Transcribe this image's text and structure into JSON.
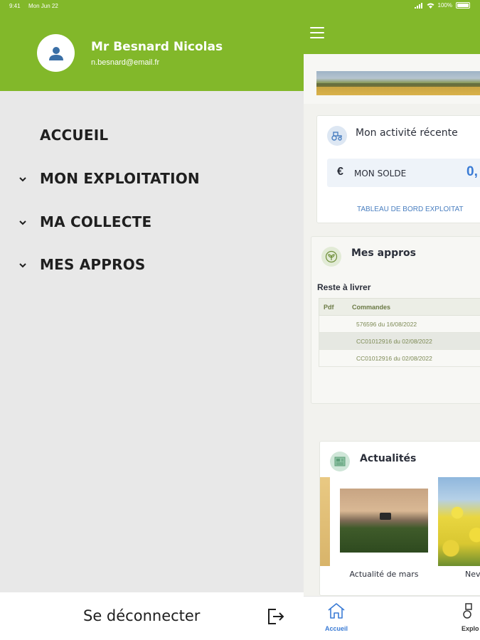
{
  "status_bar": {
    "time": "9:41",
    "date": "Mon Jun 22",
    "battery": "100%"
  },
  "drawer": {
    "user": {
      "name": "Mr Besnard Nicolas",
      "email": "n.besnard@email.fr",
      "avatar_icon": "user-icon"
    },
    "menu": [
      {
        "label": "ACCUEIL",
        "expandable": false
      },
      {
        "label": "MON EXPLOITATION",
        "expandable": true
      },
      {
        "label": "MA COLLECTE",
        "expandable": true
      },
      {
        "label": "MES APPROS",
        "expandable": true
      }
    ],
    "logout_label": "Se déconnecter"
  },
  "app": {
    "header_icon": "hamburger-icon",
    "activity": {
      "title": "Mon activité récente",
      "currency_symbol": "€",
      "solde_label": "MON SOLDE",
      "solde_value": "0,",
      "dashboard_link": "TABLEAU DE BORD EXPLOITAT"
    },
    "appros": {
      "title": "Mes appros",
      "reste_label": "Reste à livrer",
      "columns": [
        "Pdf",
        "Commandes"
      ],
      "rows": [
        {
          "commande": "576596 du 16/08/2022"
        },
        {
          "commande": "CC01012916 du 02/08/2022"
        },
        {
          "commande": "CC01012916 du 02/08/2022"
        }
      ]
    },
    "news": {
      "title": "Actualités",
      "items": [
        {
          "caption": "Actualité de mars"
        },
        {
          "caption": "Nev"
        }
      ]
    },
    "tabs": [
      {
        "label": "Accueil",
        "icon": "home-icon",
        "active": true
      },
      {
        "label": "Explo",
        "icon": "tractor-icon",
        "active": false
      }
    ]
  },
  "colors": {
    "brand_green": "#82b82a",
    "drawer_bg": "#e8e8e8",
    "accent_blue": "#3a7bd5"
  }
}
